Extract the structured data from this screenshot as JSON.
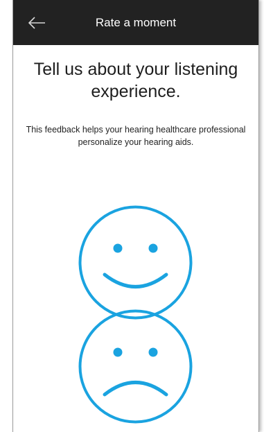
{
  "header": {
    "title": "Rate a moment",
    "back_icon": "arrow-left-icon"
  },
  "main": {
    "heading": "Tell us about your listening experience.",
    "description": "This feedback helps your hearing healthcare professional personalize your hearing aids.",
    "ratings": [
      {
        "icon": "happy-face-icon"
      },
      {
        "icon": "sad-face-icon"
      }
    ]
  },
  "colors": {
    "header_bg": "#222222",
    "accent": "#1aa3e0",
    "text": "#1e1e1e"
  }
}
